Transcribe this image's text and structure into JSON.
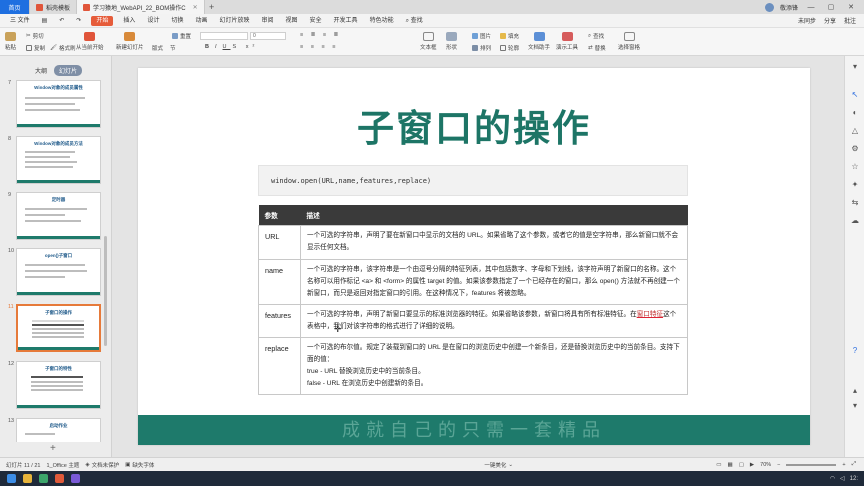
{
  "tabbar": {
    "home": "首页",
    "tabs": [
      {
        "label": "稻壳模板",
        "color": "#e0553a"
      },
      {
        "label": "学习猿地_WebAPI_22_BOM操作C",
        "color": "#e0553a",
        "active": true
      }
    ],
    "user": "敬添锋"
  },
  "menubar": {
    "file": "三 文件",
    "items": [
      "开始",
      "插入",
      "设计",
      "切换",
      "动画",
      "幻灯片放映",
      "审阅",
      "视图",
      "安全",
      "开发工具",
      "特色功能",
      "查找"
    ],
    "right": [
      "未同步",
      "分享",
      "批注"
    ]
  },
  "ribbon": {
    "paste": "粘贴",
    "cut": "剪切",
    "copy": "复制",
    "format_painter": "格式刷",
    "from_start": "从当前开始",
    "new_slide": "新建幻灯片",
    "layout": "版式",
    "section": "节",
    "reset": "重置",
    "font_size": "0",
    "textbox": "文本框",
    "shape": "形状",
    "arrange": "排列",
    "outline": "轮廓",
    "image": "图片",
    "fill": "填充",
    "doc_assistant": "文档助手",
    "presentation_tools": "演示工具",
    "find": "查找",
    "replace": "替换",
    "select_pane": "选择窗格"
  },
  "leftpanel": {
    "tabs": [
      "大纲",
      "幻灯片"
    ],
    "slides": [
      {
        "num": "7",
        "title": "Window对象的成员属性"
      },
      {
        "num": "8",
        "title": "Window对象的成员方法"
      },
      {
        "num": "9",
        "title": "定时器"
      },
      {
        "num": "10",
        "title": "open()子窗口"
      },
      {
        "num": "11",
        "title": "子窗口的操作"
      },
      {
        "num": "12",
        "title": "子窗口的特性"
      },
      {
        "num": "13",
        "title": "启动作业"
      }
    ]
  },
  "slide": {
    "title": "子窗口的操作",
    "code": "window.open(URL,name,features,replace)",
    "table": {
      "headers": [
        "参数",
        "描述"
      ],
      "rows": [
        {
          "param": "URL",
          "desc": "一个可选的字符串，声明了要在新窗口中显示的文档的 URL。如果省略了这个参数，或者它的值是空字符串，那么新窗口就不会显示任何文档。"
        },
        {
          "param": "name",
          "desc": "一个可选的字符串，该字符串是一个由逗号分隔的特征列表，其中包括数字、字母和下划线，该字符声明了新窗口的名称。这个名称可以用作标记 <a> 和 <form> 的属性 target 的值。如果该参数指定了一个已经存在的窗口，那么 open() 方法就不再创建一个新窗口，而只是返回对指定窗口的引用。在这种情况下，features 将被忽略。"
        },
        {
          "param": "features",
          "desc_a": "一个可选的字符串，声明了新窗口要显示的标准浏览器的特征。如果省略该参数，新窗口将具有所有标准特征。在",
          "desc_link": "窗口特征",
          "desc_b": "这个表格中，我们对该字符串的格式进行了详细的说明。"
        },
        {
          "param": "replace",
          "lines": [
            "一个可选的布尔值。规定了装载到窗口的 URL 是在窗口的浏览历史中创建一个新条目，还是替换浏览历史中的当前条目。支持下面的值：",
            "true - URL 替换浏览历史中的当前条目。",
            "false - URL 在浏览历史中创建新的条目。"
          ]
        }
      ]
    },
    "footer": "成就自己的只需一套精品"
  },
  "statusbar": {
    "slide": "幻灯片 11 / 21",
    "theme": "1_Office 主题",
    "protect": "文档未保护",
    "font_missing": "缺失字体",
    "beautify": "一键美化",
    "zoom": "70%"
  },
  "taskbar": {
    "time": "12:"
  }
}
